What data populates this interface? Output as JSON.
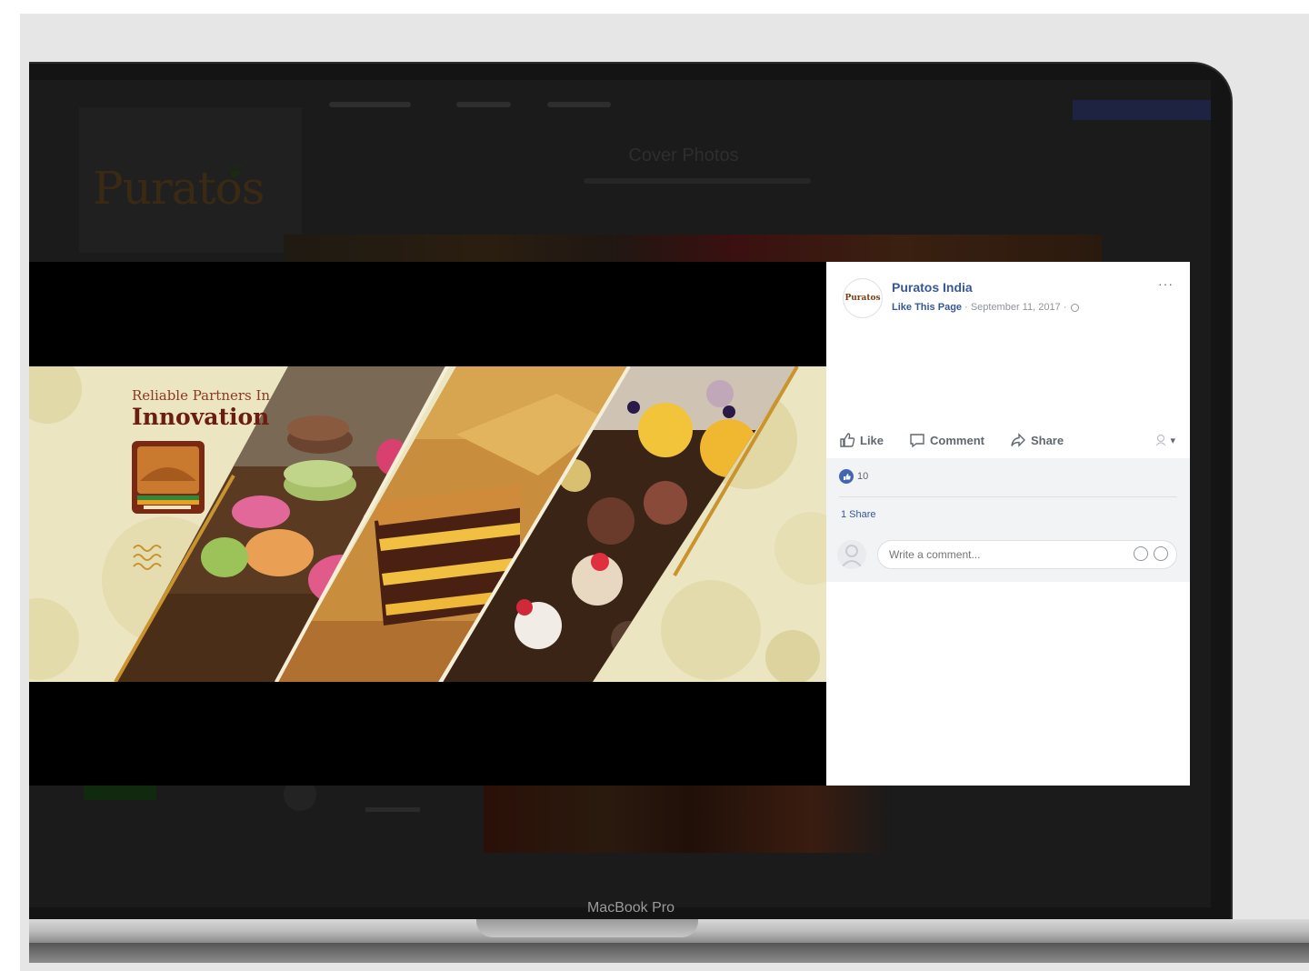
{
  "device": {
    "bezel_label": "MacBook Pro"
  },
  "background_page": {
    "brand_logo": "Puratos",
    "section_title": "Cover Photos"
  },
  "cover_image": {
    "tagline": "Reliable Partners In",
    "headline": "Innovation"
  },
  "post": {
    "page_name": "Puratos India",
    "avatar_text": "Puratos",
    "like_page": "Like This Page",
    "separator": " · ",
    "date": "September 11, 2017",
    "more": "···",
    "actions": {
      "like": "Like",
      "comment": "Comment",
      "share": "Share"
    },
    "reaction_count": "10",
    "shares": "1 Share",
    "comment_placeholder": "Write a comment..."
  },
  "colors": {
    "facebook_link": "#365899",
    "like_blue": "#4267b2",
    "cover_cream": "#ece5c1",
    "cover_gold": "#c9932e",
    "headline_brown": "#6b1d10"
  },
  "icons": [
    "thumbs-up-icon",
    "comment-icon",
    "share-icon",
    "globe-icon",
    "more-icon",
    "emoji-icon",
    "sticker-icon",
    "audience-icon"
  ]
}
